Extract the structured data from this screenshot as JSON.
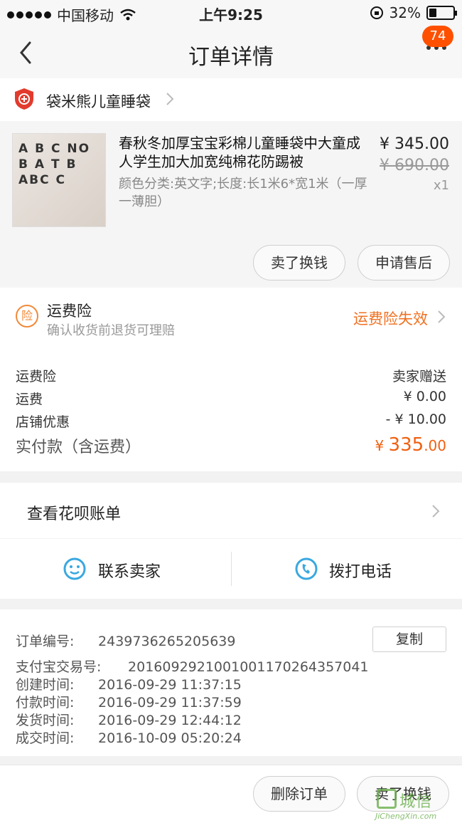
{
  "status_bar": {
    "carrier": "中国移动",
    "time": "上午9:25",
    "battery": "32%",
    "battery_level": 0.32
  },
  "nav": {
    "title": "订单详情",
    "badge": "74",
    "icons": [
      "back-arrow-icon",
      "more-dots-icon"
    ]
  },
  "shop": {
    "name": "袋米熊儿童睡袋",
    "icon": "enterprise-shield-icon"
  },
  "product": {
    "title": "春秋冬加厚宝宝彩棉儿童睡袋中大童成人学生加大加宽纯棉花防踢被",
    "sku": "颜色分类:英文字;长度:长1米6*宽1米（一厚一薄胆）",
    "price": "¥ 345.00",
    "original_price": "¥ 690.00",
    "quantity": "x1",
    "thumb_letters": "A B C NO B A T B ABC C",
    "buttons": {
      "resell": "卖了换钱",
      "after_sales": "申请售后"
    }
  },
  "insurance": {
    "icon_text": "险",
    "title": "运费险",
    "subtitle": "确认收货前退货可理赔",
    "status": "运费险失效"
  },
  "fees": [
    {
      "label": "运费险",
      "value": "卖家赠送"
    },
    {
      "label": "运费",
      "value": "¥ 0.00"
    },
    {
      "label": "店铺优惠",
      "value": "- ¥ 10.00"
    }
  ],
  "total": {
    "label": "实付款（含运费）",
    "currency": "¥ ",
    "integer": "335",
    "decimal": ".00"
  },
  "huabei": {
    "label": "查看花呗账单"
  },
  "contact": {
    "seller": "联系卖家",
    "phone": "拨打电话"
  },
  "order_info": {
    "copy_label": "复制",
    "lines": [
      {
        "key": "订单编号:",
        "value": "2439736265205639"
      },
      {
        "key": "支付宝交易号:",
        "value": "2016092921001001170264357041"
      },
      {
        "key": "创建时间:",
        "value": "2016-09-29 11:37:15"
      },
      {
        "key": "付款时间:",
        "value": "2016-09-29 11:37:59"
      },
      {
        "key": "发货时间:",
        "value": "2016-09-29 12:44:12"
      },
      {
        "key": "成交时间:",
        "value": "2016-10-09 05:20:24"
      }
    ]
  },
  "bottom_bar": {
    "delete": "删除订单",
    "resell": "卖了换钱"
  },
  "watermark": {
    "text": "城信",
    "sub": "JiChengXin.com"
  },
  "colors": {
    "accent": "#ff5000",
    "price_orange": "#f06010",
    "contact_blue": "#3aa8e0"
  }
}
